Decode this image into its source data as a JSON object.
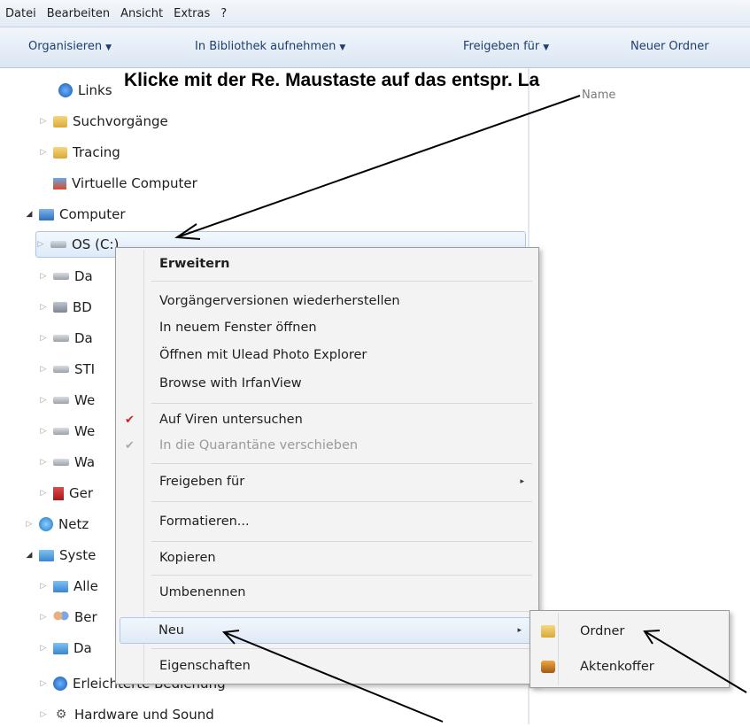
{
  "menubar": {
    "items": [
      "Datei",
      "Bearbeiten",
      "Ansicht",
      "Extras",
      "?"
    ]
  },
  "toolbar": {
    "organize": "Organisieren",
    "library": "In Bibliothek aufnehmen",
    "share": "Freigeben für",
    "new_folder": "Neuer Ordner",
    "dropdown_glyph": "▼"
  },
  "annotation": {
    "text": "Klicke mit der Re. Maustaste auf das entspr. La"
  },
  "content": {
    "column_header": "Name"
  },
  "tree": [
    {
      "label": "Links",
      "icon": "links-folder-icon"
    },
    {
      "label": "Suchvorgänge",
      "icon": "search-folder-icon"
    },
    {
      "label": "Tracing",
      "icon": "folder-icon"
    },
    {
      "label": "Virtuelle Computer",
      "icon": "virtual-machines-icon"
    },
    {
      "label": "Computer",
      "icon": "computer-icon"
    },
    {
      "label": "OS (C:)",
      "icon": "system-drive-icon"
    },
    {
      "label": "Da",
      "icon": "drive-icon"
    },
    {
      "label": "BD",
      "icon": "optical-drive-icon"
    },
    {
      "label": "Da",
      "icon": "drive-icon"
    },
    {
      "label": "STI",
      "icon": "usb-drive-icon"
    },
    {
      "label": "We",
      "icon": "network-drive-icon"
    },
    {
      "label": "We",
      "icon": "network-drive-icon"
    },
    {
      "label": "Wa",
      "icon": "drive-icon"
    },
    {
      "label": "Ger",
      "icon": "device-icon"
    },
    {
      "label": "Netz",
      "icon": "network-icon"
    },
    {
      "label": "Syste",
      "icon": "control-panel-icon"
    },
    {
      "label": "Alle",
      "icon": "control-panel-icon"
    },
    {
      "label": "Ber",
      "icon": "user-accounts-icon"
    },
    {
      "label": "Da",
      "icon": "date-time-icon"
    },
    {
      "label": "Erleichterte Bedienung",
      "icon": "ease-of-access-icon"
    },
    {
      "label": "Hardware und Sound",
      "icon": "hardware-sound-icon"
    }
  ],
  "context_menu": {
    "items": [
      {
        "label": "Erweitern",
        "bold": true
      },
      {
        "label": "Vorgängerversionen wiederherstellen"
      },
      {
        "label": "In neuem Fenster öffnen"
      },
      {
        "label": "Öffnen mit Ulead Photo Explorer"
      },
      {
        "label": "Browse with IrfanView"
      },
      {
        "label": "Auf Viren untersuchen",
        "icon": "antivirus-icon"
      },
      {
        "label": "In die Quarantäne verschieben",
        "icon": "quarantine-icon",
        "disabled": true
      },
      {
        "label": "Freigeben für",
        "submenu": true
      },
      {
        "label": "Formatieren..."
      },
      {
        "label": "Kopieren"
      },
      {
        "label": "Umbenennen"
      },
      {
        "label": "Neu",
        "submenu": true,
        "highlighted": true
      },
      {
        "label": "Eigenschaften"
      }
    ],
    "submenu_glyph": "▸"
  },
  "submenu_neu": {
    "items": [
      {
        "label": "Ordner",
        "icon": "new-folder-icon"
      },
      {
        "label": "Aktenkoffer",
        "icon": "briefcase-icon"
      }
    ]
  }
}
